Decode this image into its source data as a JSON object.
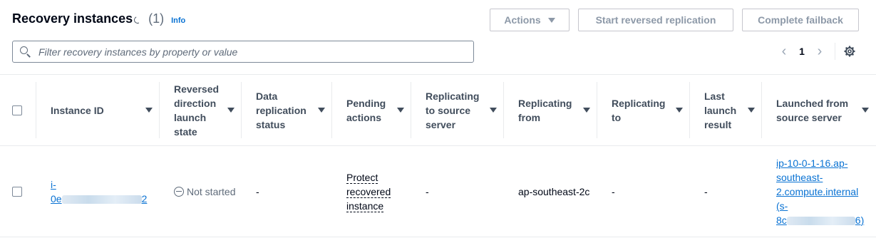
{
  "header": {
    "title": "Recovery instances",
    "count": "(1)",
    "info": "Info"
  },
  "buttons": {
    "actions": "Actions",
    "reverse_replication": "Start reversed replication",
    "complete_failback": "Complete failback"
  },
  "search": {
    "placeholder": "Filter recovery instances by property or value"
  },
  "pagination": {
    "current_page": "1",
    "prev_icon": "chevron-left-icon",
    "next_icon": "chevron-right-icon"
  },
  "settings_icon": "gear-icon",
  "columns": [
    "Instance ID",
    "Reversed direction launch state",
    "Data replication status",
    "Pending actions",
    "Replicating to source server",
    "Replicating from",
    "Replicating to",
    "Last launch result",
    "Launched from source server"
  ],
  "rows": [
    {
      "instance_id_prefix": "i-",
      "instance_id_partial": "0e",
      "instance_id_suffix": "2",
      "launch_state": "Not started",
      "data_replication_status": "-",
      "pending_actions": "Protect recovered instance",
      "replicating_to_source_server": "-",
      "replicating_from": "ap-southeast-2c",
      "replicating_to": "-",
      "last_launch_result": "-",
      "launched_from": "ip-10-0-1-16.ap-southeast-2.compute.internal",
      "launched_from_id_prefix": "(s-",
      "launched_from_id_partial": "8c",
      "launched_from_id_suffix": "6)"
    }
  ]
}
